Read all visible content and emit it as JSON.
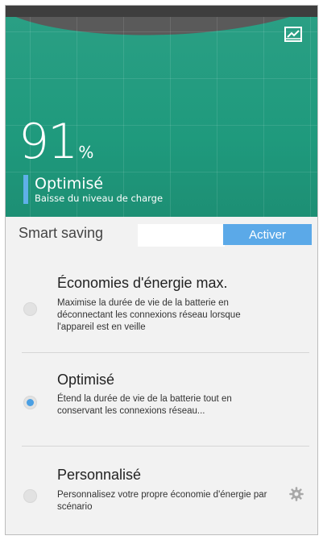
{
  "hero": {
    "battery_percent": "91",
    "percent_sign": "%",
    "mode_title": "Optimisé",
    "mode_subtitle": "Baisse du niveau de charge",
    "graph_icon": "graph-icon"
  },
  "smart_saving": {
    "label": "Smart saving",
    "field_value": "",
    "activate_label": "Activer"
  },
  "options": [
    {
      "title": "Économies d'énergie max.",
      "description": "Maximise la durée de vie de la batterie en déconnectant les connexions réseau lorsque l'appareil est en veille",
      "selected": false
    },
    {
      "title": "Optimisé",
      "description": "Étend la durée de vie de la batterie tout en conservant les connexions réseau...",
      "selected": true
    },
    {
      "title": "Personnalisé",
      "description": "Personnalisez votre propre économie d'énergie par scénario",
      "selected": false,
      "icon": "gear-icon"
    }
  ],
  "colors": {
    "hero_green": "#1f9a7d",
    "accent_blue": "#5ba9e8",
    "radio_selected": "#4a9fe3"
  }
}
